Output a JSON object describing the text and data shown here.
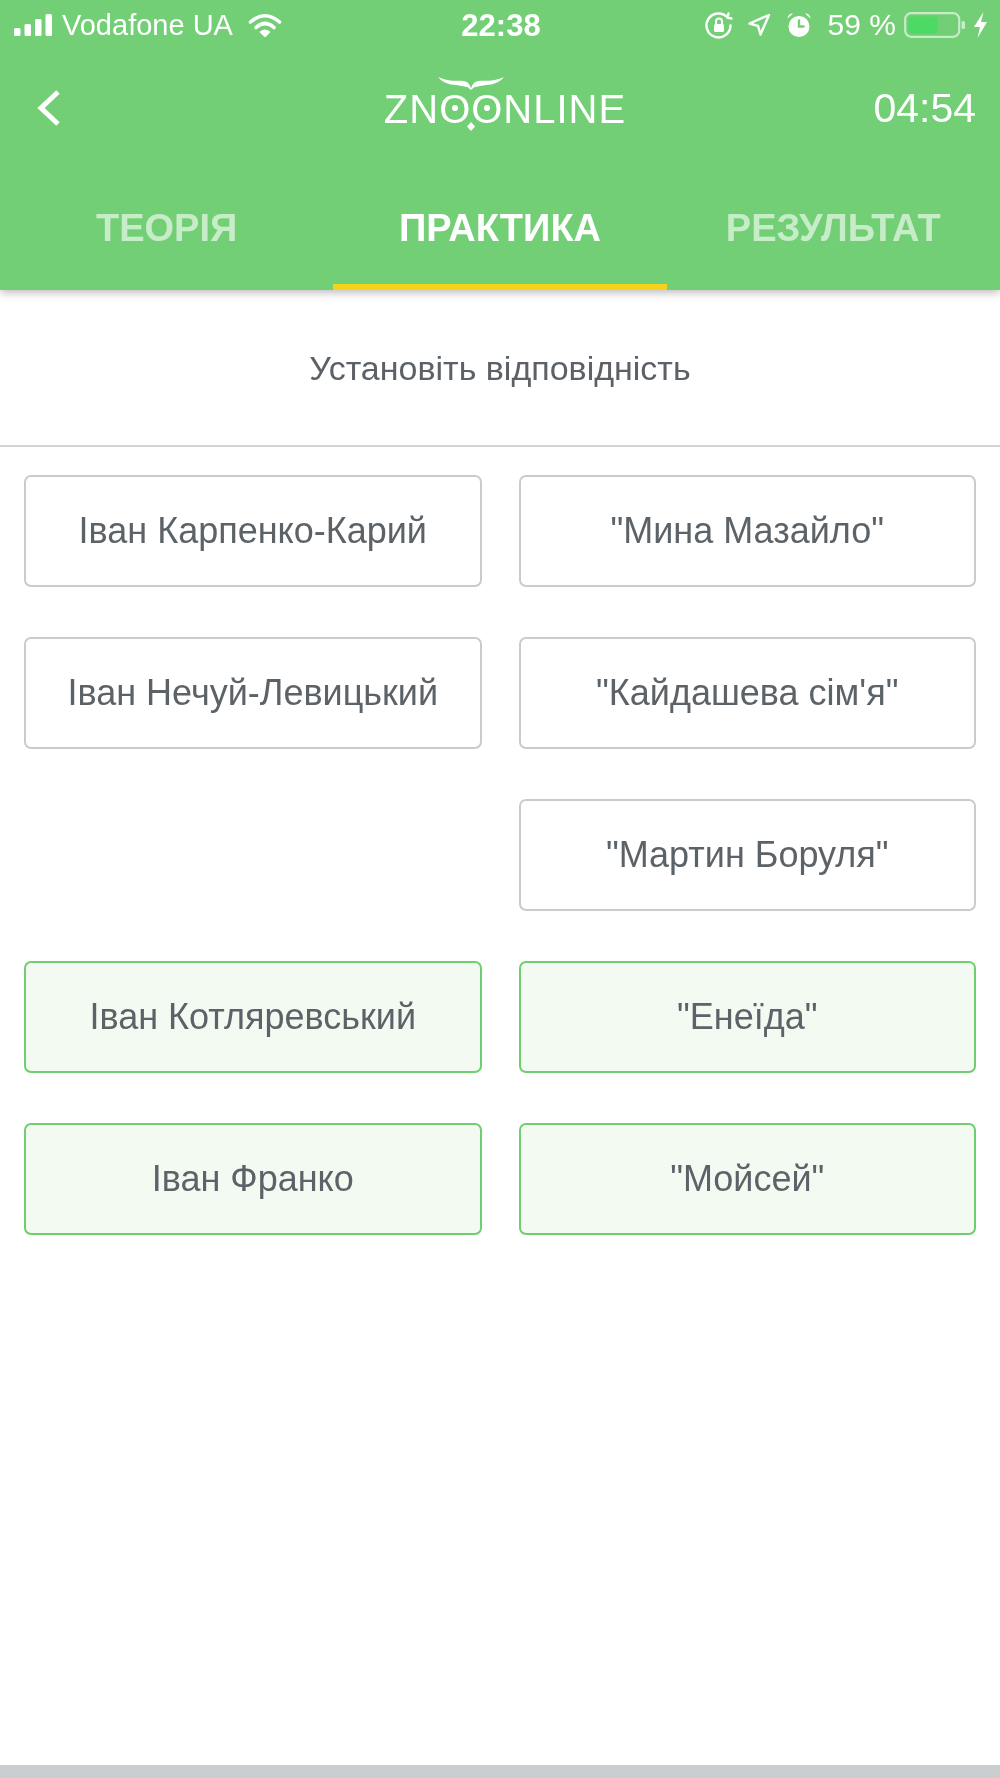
{
  "status_bar": {
    "carrier": "Vodafone UA",
    "time": "22:38",
    "battery": "59 %"
  },
  "header": {
    "logo": "ZNOONLINE",
    "timer": "04:54"
  },
  "tabs": [
    {
      "label": "ТЕОРІЯ",
      "selected": false
    },
    {
      "label": "ПРАКТИКА",
      "selected": true
    },
    {
      "label": "РЕЗУЛЬТАТ",
      "selected": false
    }
  ],
  "instruction": "Установіть відповідність",
  "rows": [
    {
      "left": {
        "text": "Іван Карпенко-Карий",
        "matched": false
      },
      "right": {
        "text": "\"Мина Мазайло\"",
        "matched": false
      }
    },
    {
      "left": {
        "text": "Іван Нечуй-Левицький",
        "matched": false
      },
      "right": {
        "text": "\"Кайдашева сім'я\"",
        "matched": false
      }
    },
    {
      "right": {
        "text": "\"Мартин Боруля\"",
        "matched": false
      }
    },
    {
      "left": {
        "text": "Іван Котляревський",
        "matched": true
      },
      "right": {
        "text": "\"Енеїда\"",
        "matched": true
      }
    },
    {
      "left": {
        "text": "Іван Франко",
        "matched": true
      },
      "right": {
        "text": "\"Мойсей\"",
        "matched": true
      }
    }
  ]
}
